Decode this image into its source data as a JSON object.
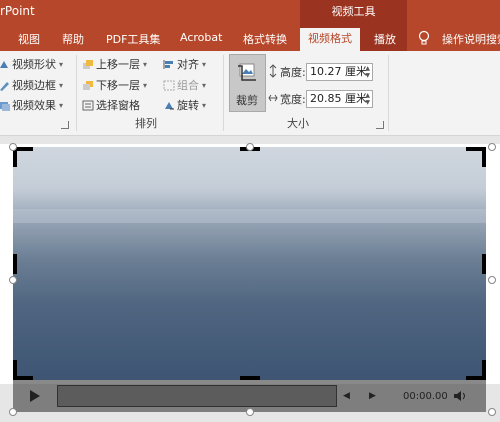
{
  "window": {
    "app_title": "rPoint",
    "contextual_group": "视频工具"
  },
  "tabs": [
    {
      "label": "视图"
    },
    {
      "label": "帮助"
    },
    {
      "label": "PDF工具集"
    },
    {
      "label": "Acrobat"
    },
    {
      "label": "格式转换"
    },
    {
      "label": "视频格式",
      "active": true
    },
    {
      "label": "播放"
    }
  ],
  "tell_me": "操作说明搜索",
  "ribbon": {
    "video_styles": {
      "shape": "视频形状",
      "border": "视频边框",
      "effects": "视频效果"
    },
    "arrange": {
      "group_label": "排列",
      "bring_forward": "上移一层",
      "send_backward": "下移一层",
      "selection_pane": "选择窗格",
      "align": "对齐",
      "group": "组合",
      "rotate": "旋转"
    },
    "size": {
      "group_label": "大小",
      "crop": "裁剪",
      "height_label": "高度:",
      "height_value": "10.27 厘米",
      "width_label": "宽度:",
      "width_value": "20.85 厘米"
    }
  },
  "player": {
    "timecode": "00:00.00"
  },
  "colors": {
    "accent": "#b7472a",
    "contextual": "#9a3420",
    "ribbon_bg": "#f3f3f3"
  }
}
